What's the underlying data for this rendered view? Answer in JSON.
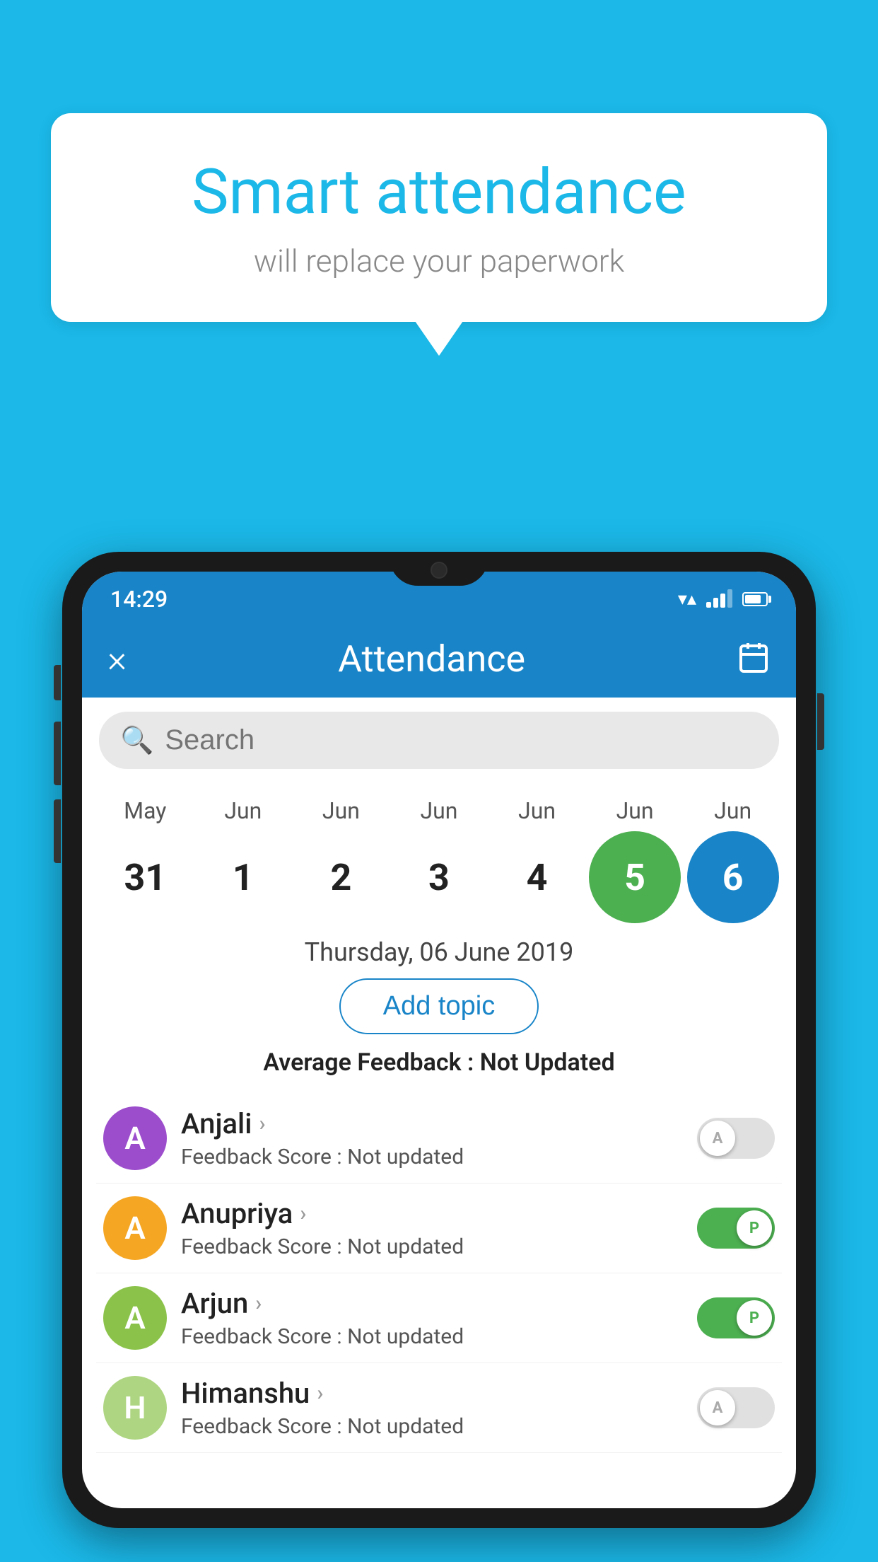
{
  "background_color": "#1bb8e8",
  "speech_bubble": {
    "title": "Smart attendance",
    "subtitle": "will replace your paperwork"
  },
  "status_bar": {
    "time": "14:29"
  },
  "app_header": {
    "title": "Attendance",
    "close_label": "×"
  },
  "search": {
    "placeholder": "Search"
  },
  "calendar": {
    "months": [
      "May",
      "Jun",
      "Jun",
      "Jun",
      "Jun",
      "Jun",
      "Jun"
    ],
    "days": [
      "31",
      "1",
      "2",
      "3",
      "4",
      "5",
      "6"
    ],
    "day_states": [
      "normal",
      "normal",
      "normal",
      "normal",
      "normal",
      "today",
      "selected"
    ]
  },
  "selected_date": "Thursday, 06 June 2019",
  "add_topic_label": "Add topic",
  "avg_feedback_label": "Average Feedback : ",
  "avg_feedback_value": "Not Updated",
  "students": [
    {
      "name": "Anjali",
      "avatar_letter": "A",
      "avatar_color": "#9c4dcc",
      "feedback_label": "Feedback Score : ",
      "feedback_value": "Not updated",
      "attendance": "absent"
    },
    {
      "name": "Anupriya",
      "avatar_letter": "A",
      "avatar_color": "#f5a623",
      "feedback_label": "Feedback Score : ",
      "feedback_value": "Not updated",
      "attendance": "present"
    },
    {
      "name": "Arjun",
      "avatar_letter": "A",
      "avatar_color": "#8bc34a",
      "feedback_label": "Feedback Score : ",
      "feedback_value": "Not updated",
      "attendance": "present"
    },
    {
      "name": "Himanshu",
      "avatar_letter": "H",
      "avatar_color": "#aed581",
      "feedback_label": "Feedback Score : ",
      "feedback_value": "Not updated",
      "attendance": "absent"
    }
  ]
}
